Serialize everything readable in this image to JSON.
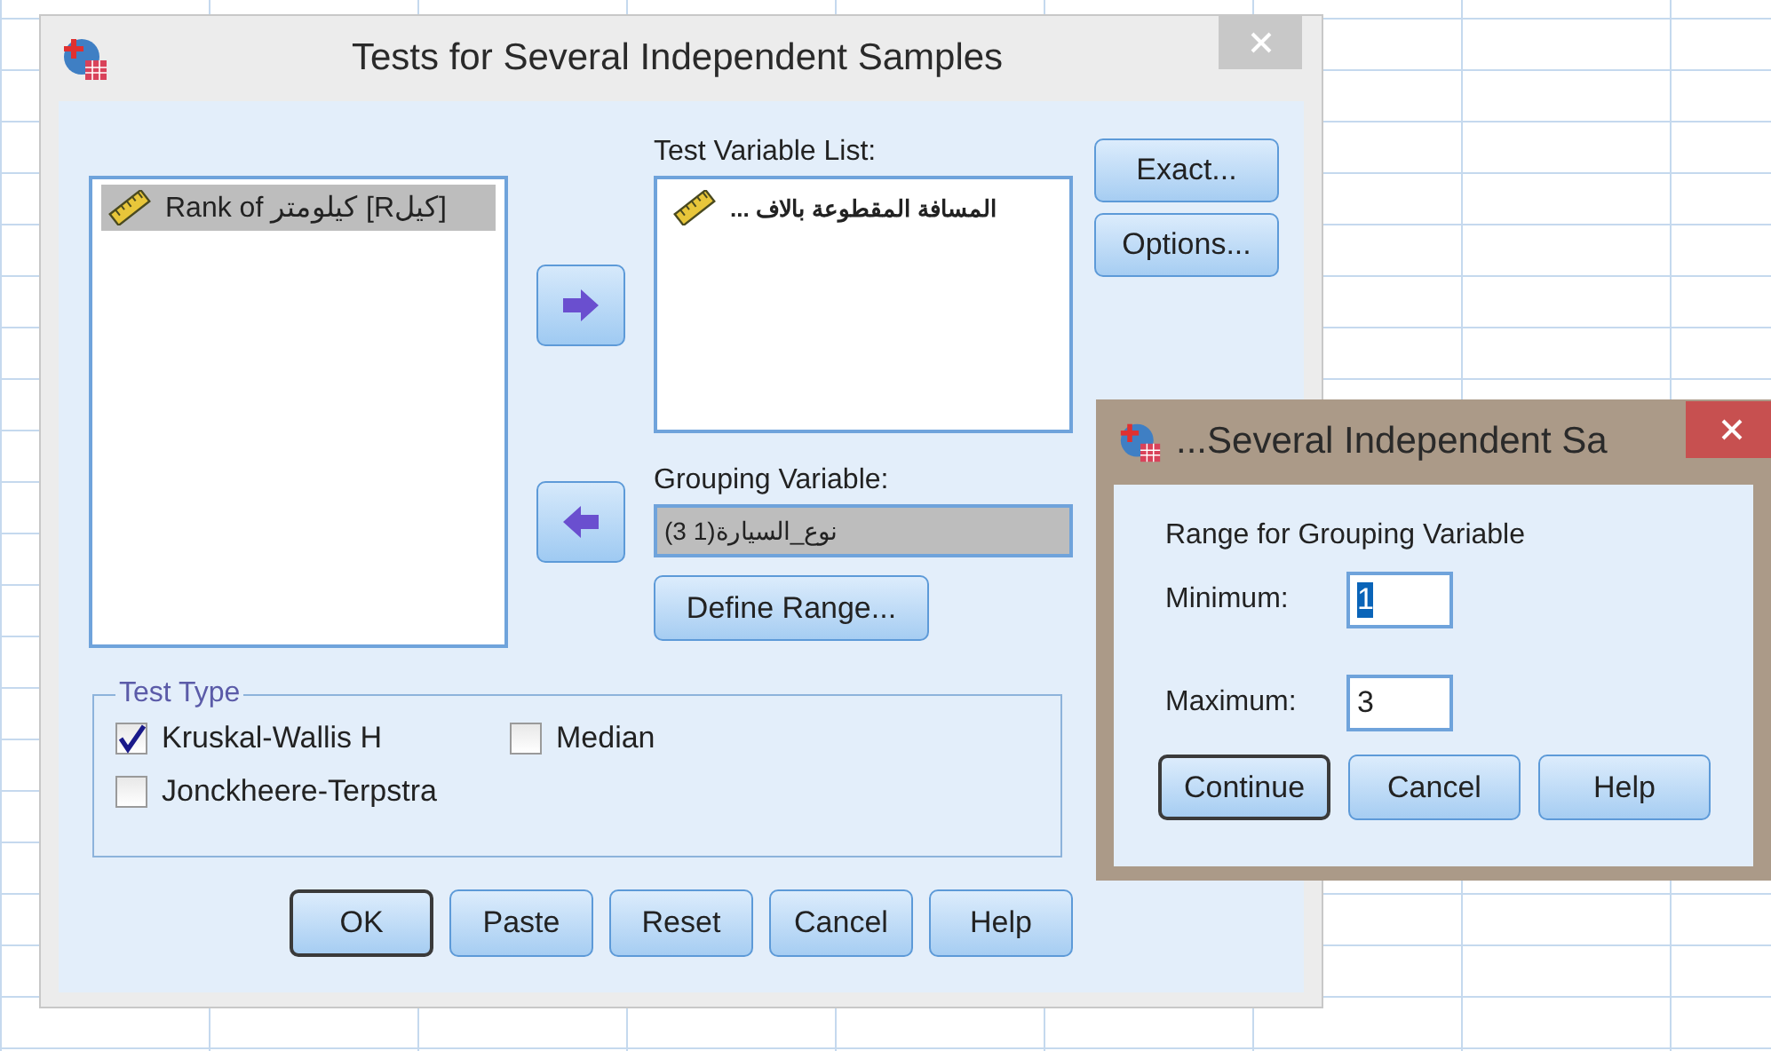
{
  "main_dialog": {
    "title": "Tests for Several Independent Samples",
    "source_list": {
      "items": [
        {
          "label": "Rank of كيلومتر [Rكيل]",
          "selected": true
        }
      ]
    },
    "test_variable_list": {
      "label": "Test Variable List:",
      "items": [
        {
          "label": "المسافة المقطوعة بالاف ...",
          "selected": false
        }
      ]
    },
    "grouping_variable": {
      "label": "Grouping Variable:",
      "value": "نوع_السيارة(1 3)"
    },
    "define_range_button": "Define Range...",
    "side_buttons": [
      {
        "label": "Exact..."
      },
      {
        "label": "Options..."
      }
    ],
    "test_type": {
      "title": "Test Type",
      "options": [
        {
          "label": "Kruskal-Wallis H",
          "checked": true
        },
        {
          "label": "Median",
          "checked": false
        },
        {
          "label": "Jonckheere-Terpstra",
          "checked": false
        }
      ]
    },
    "buttons": [
      {
        "label": "OK",
        "default": true
      },
      {
        "label": "Paste",
        "default": false
      },
      {
        "label": "Reset",
        "default": false
      },
      {
        "label": "Cancel",
        "default": false
      },
      {
        "label": "Help",
        "default": false
      }
    ]
  },
  "range_dialog": {
    "title": "...Several Independent Sa",
    "heading": "Range for Grouping Variable",
    "fields": [
      {
        "label": "Minimum:",
        "value": "1",
        "text_selected": true
      },
      {
        "label": "Maximum:",
        "value": "3",
        "text_selected": false
      }
    ],
    "buttons": [
      {
        "label": "Continue",
        "default": true
      },
      {
        "label": "Cancel",
        "default": false
      },
      {
        "label": "Help",
        "default": false
      }
    ]
  }
}
